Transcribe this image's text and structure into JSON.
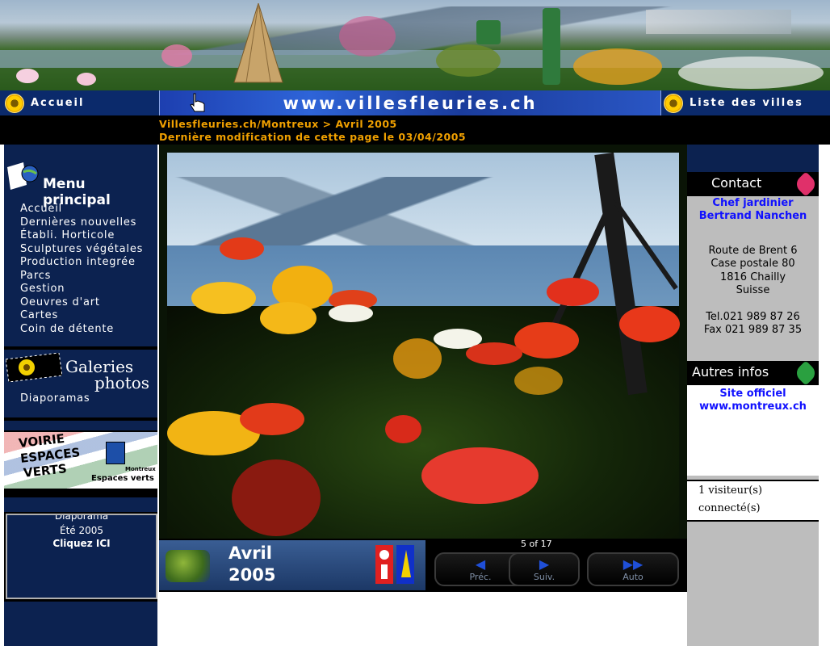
{
  "nav": {
    "home_label": "Accueil",
    "site_url": "www.villesfleuries.ch",
    "cities_label": "Liste des villes"
  },
  "breadcrumb": {
    "path": "Villesfleuries.ch/Montreux > Avril 2005",
    "last_modified": "Dernière modification de cette page le 03/04/2005"
  },
  "menu": {
    "title": "Menu principal",
    "items": [
      "Accueil",
      "Dernières nouvelles",
      "Établi. Horticole",
      "Sculptures végétales",
      "Production integrée",
      "Parcs",
      "Gestion",
      "Oeuvres d'art",
      "Cartes",
      "Coin de détente"
    ]
  },
  "gallery": {
    "title_line1": "Galeries",
    "title_line2": "photos",
    "items": [
      "Diaporamas"
    ]
  },
  "banner_ad": {
    "line1": "VOIRIE",
    "line2": "ESPACES",
    "line3": "VERTS",
    "brand": "Montreux",
    "brand_sub": "Espaces verts"
  },
  "promo": {
    "line1": "Diaporama",
    "line2": "Été 2005",
    "line3": "Cliquez ICI"
  },
  "slideshow": {
    "caption_line1": "Avril",
    "caption_line2": "2005",
    "counter": "5 of 17",
    "prev_label": "Préc.",
    "next_label": "Suiv.",
    "auto_label": "Auto"
  },
  "contact": {
    "title": "Contact",
    "role": "Chef jardinier",
    "name": "Bertrand Nanchen",
    "address": [
      "Route de Brent 6",
      "Case postale 80",
      "1816 Chailly",
      "Suisse"
    ],
    "tel": "Tel.021 989 87 26",
    "fax": "Fax 021 989 87 35"
  },
  "other_info": {
    "title": "Autres infos",
    "link_label": "Site officiel",
    "link_url": "www.montreux.ch"
  },
  "visitors": {
    "line1": "1 visiteur(s)",
    "line2": "connecté(s)"
  },
  "colors": {
    "nav_blue": "#0b2a6b",
    "crumb_orange": "#f0a000",
    "sidebar_navy": "#0c2250",
    "link_blue": "#1010ff",
    "right_gray": "#bdbdbd"
  }
}
